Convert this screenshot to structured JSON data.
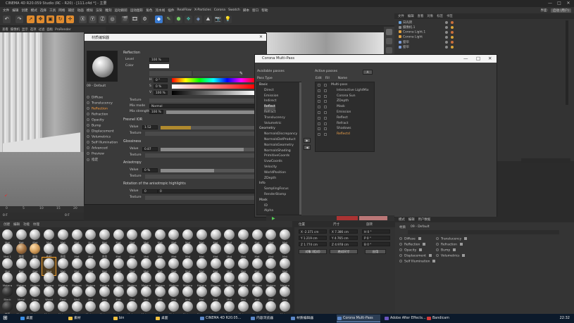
{
  "window": {
    "title": "CINEMA 4D R20.059 Studio (RC - R20) - [111.c4d *] - 主要",
    "minimize": "—",
    "maximize": "□",
    "close": "✕"
  },
  "menubar": {
    "items": [
      "文件",
      "编辑",
      "创建",
      "模式",
      "选择",
      "工具",
      "网格",
      "捕捉",
      "动画",
      "模拟",
      "渲染",
      "雕刻",
      "运动跟踪",
      "运动图形",
      "角色",
      "流水线",
      "插件",
      "RealFlow",
      "X-Particles",
      "Corona",
      "Swatch",
      "脚本",
      "窗口",
      "帮助"
    ],
    "right": {
      "label": "界面:",
      "layout": "启动 (用户)"
    }
  },
  "submenu": {
    "items": [
      "查看",
      "摄像机",
      "显示",
      "选项",
      "过滤",
      "面板",
      "ProRender"
    ]
  },
  "object_manager": {
    "header": [
      "文件",
      "编辑",
      "查看",
      "对象",
      "标签",
      "书签"
    ],
    "objects": [
      {
        "name": "日光阴",
        "color": "#6aa0d8"
      },
      {
        "name": "摄像机.1",
        "color": "#8b8b8b"
      },
      {
        "name": "Corona Light.1",
        "color": "#e0a040"
      },
      {
        "name": "Corona Light",
        "color": "#e0a040"
      },
      {
        "name": "窗帘",
        "color": "#7a9bd6"
      },
      {
        "name": "窗帘",
        "color": "#7a9bd6"
      }
    ]
  },
  "material_editor": {
    "title": "材质编辑器",
    "material_name": "09 - Default",
    "channels": [
      {
        "label": "Diffuse",
        "active": false
      },
      {
        "label": "Translucency",
        "active": false
      },
      {
        "label": "Reflection",
        "active": true
      },
      {
        "label": "Refraction",
        "active": false
      },
      {
        "label": "Opacity",
        "active": false
      },
      {
        "label": "Bump",
        "active": false
      },
      {
        "label": "Displacement",
        "active": false
      },
      {
        "label": "Volumetrics",
        "active": false
      },
      {
        "label": "Self Illumination",
        "active": false
      },
      {
        "label": "Advanced",
        "active": false
      },
      {
        "label": "Preview",
        "active": false
      },
      {
        "label": "指定",
        "active": false
      }
    ],
    "section_title": "Reflection",
    "level_label": "Level",
    "level_value": "100 %",
    "color_label": "Color",
    "h_label": "H",
    "h_value": "0 °",
    "s_label": "S",
    "s_value": "0 %",
    "v_label": "V",
    "v_value": "100 %",
    "texture_label": "Texture",
    "mix_mode_label": "Mix mode",
    "mix_mode_value": "Normal",
    "mix_strength_label": "Mix strength",
    "mix_strength_value": "100 %",
    "fresnel_title": "Fresnel IOR",
    "fresnel_value_label": "Value",
    "fresnel_value": "1.52",
    "fresnel_fill": 0.32,
    "glossiness_title": "Glossiness",
    "gloss_value_label": "Value",
    "gloss_value": "0.87",
    "anisotropy_title": "Anisotropy",
    "aniso_value_label": "Value",
    "aniso_value": "0 %",
    "rotation_title": "Rotation of the anisotropic highlights",
    "rot_value_label": "Value",
    "rot_value": "0",
    "rot_unit": "0"
  },
  "multipass": {
    "title": "Corona Multi-Pass",
    "available_title": "Available passes",
    "pass_type_title": "Pass Type",
    "active_title": "Active passes",
    "add_btn": "A",
    "available": [
      {
        "label": "Basic",
        "cat": true
      },
      {
        "label": "Direct"
      },
      {
        "label": "Emission"
      },
      {
        "label": "Indirect"
      },
      {
        "label": "Reflect",
        "hl": true
      },
      {
        "label": "Refract"
      },
      {
        "label": "Translucency"
      },
      {
        "label": "Volumetric"
      },
      {
        "label": "Geometry",
        "cat": true
      },
      {
        "label": "NormalsDiscrepancy"
      },
      {
        "label": "NormalsDotProduct"
      },
      {
        "label": "NormalsGeometry"
      },
      {
        "label": "NormalsShading"
      },
      {
        "label": "PrimitiveCoords"
      },
      {
        "label": "UvwCoords"
      },
      {
        "label": "Velocity"
      },
      {
        "label": "WorldPosition"
      },
      {
        "label": "ZDepth"
      },
      {
        "label": "Info",
        "cat": true
      },
      {
        "label": "SamplingFocus"
      },
      {
        "label": "RenderStamp"
      },
      {
        "label": "Mask",
        "cat": true
      },
      {
        "label": "ID"
      },
      {
        "label": "Alpha"
      }
    ],
    "active_cols": [
      "Edit",
      "Fill",
      "Name"
    ],
    "active": [
      {
        "label": "Multi-pass"
      },
      {
        "label": "Interactive LightMix"
      },
      {
        "label": "Corona Sun"
      },
      {
        "label": "ZDepth"
      },
      {
        "label": "Mask"
      },
      {
        "label": "Emission"
      },
      {
        "label": "Reflect"
      },
      {
        "label": "Refract"
      },
      {
        "label": "Shadows"
      },
      {
        "label": "Reflectd",
        "or": true
      }
    ],
    "side_btns": [
      "▶",
      "◀"
    ]
  },
  "material_browser": {
    "tabs": [
      "创建",
      "编辑",
      "功能",
      "纹理"
    ],
    "labels": [
      "Mat",
      "Mat",
      "Mat",
      "Mat",
      "Mat",
      "Mat",
      "Mat",
      "Mat",
      "Mat",
      "Mat",
      "Mat",
      "Mat",
      "Mat",
      "Mat",
      "Mat",
      "Mat",
      "Mat",
      "Mat",
      "Mat",
      "Mat",
      "Mat",
      "Mat.1",
      "地毯",
      "纸张",
      "布料",
      "亮面",
      "Mat",
      "Mat",
      "木纹",
      "Mat",
      "Mat",
      "Mat",
      "Mat",
      "Mat",
      "Mat",
      "Mat",
      "Mat",
      "Mat",
      "Mat",
      "Mat",
      "Mat",
      "Mat",
      "Mat",
      "Mat",
      "Mat",
      "Mat",
      "Mat",
      "Mat",
      "Mat",
      "Mat",
      "Mat",
      "Mat",
      "Mat",
      "Mat",
      "Mat",
      "Mat",
      "Mat",
      "Mat",
      "Mat",
      "Mat",
      "Mat",
      "Mat",
      "Mat",
      "Matera",
      "Matera",
      "Matera",
      "Matera",
      "Matera",
      "Matera",
      "Matera",
      "Matera",
      "Matera",
      "Matera",
      "Matera",
      "Matera",
      "Matera",
      "Matera",
      "Matera",
      "Matera",
      "Matera",
      "Matera",
      "Matera",
      "Matera",
      "Matera",
      "Black",
      "Metal",
      "Glass",
      "Wood",
      "Floor",
      "Wall",
      "Mat",
      "Mat",
      "Mat",
      "Mat",
      "Mat",
      "Mat",
      "Mat",
      "Mat",
      "Mat",
      "Mat",
      "Mat",
      "Mat",
      "Mat",
      "Mat",
      "Mat",
      "地面",
      "Matera",
      "Matera",
      "Matera",
      "Matera",
      "Matera",
      "Matera",
      "Matera",
      "Matera",
      "Matera",
      "Matera",
      "Matera",
      "Matera",
      "Matera",
      "Matera",
      "Matera",
      "Matera",
      "Matera",
      "Matera",
      "Matera",
      "Matera"
    ],
    "selected_index": 45
  },
  "coordinates": {
    "headers": [
      "位置",
      "尺寸",
      "旋转"
    ],
    "pos": [
      "X  -2.371 cm",
      "Y  1.219 cm",
      "Z  1.774 cm"
    ],
    "size": [
      "X  7.386 cm",
      "Y  4.765 cm",
      "Z  4.978 cm"
    ],
    "rot": [
      "H  0 °",
      "P  0 °",
      "B  0 °"
    ],
    "mode": "对象 (相对)",
    "size_mode": "绝对尺寸",
    "apply": "应用"
  },
  "attributes": {
    "header": [
      "模式",
      "编辑",
      "用户数据"
    ],
    "material_label": "材质",
    "material_name": "09 - Default",
    "left": [
      "Diffuse",
      "Reflection",
      "Opacity",
      "Displacement",
      "Self Illumination"
    ],
    "right": [
      "Translucency",
      "Refraction",
      "Bump",
      "Volumetrics"
    ]
  },
  "viewport": {
    "ticks": [
      "0",
      "5",
      "10",
      "15",
      "20"
    ],
    "frame_left": "0 F",
    "frame_right": "0 F"
  },
  "taskbar": {
    "items": [
      {
        "label": "桌面",
        "color": "#3a8ee6"
      },
      {
        "label": "素材",
        "color": "#f0c040"
      },
      {
        "label": "bin",
        "color": "#f0c040"
      },
      {
        "label": "桌面",
        "color": "#f0c040"
      },
      {
        "label": "CINEMA 4D R20.05...",
        "color": "#5b86c6"
      },
      {
        "label": "内容浏览器",
        "color": "#5b86c6"
      },
      {
        "label": "材质编辑器",
        "color": "#5b86c6"
      },
      {
        "label": "Corona Multi-Pass",
        "color": "#5b86c6",
        "active": true
      },
      {
        "label": "Adobe After Effects...",
        "color": "#6a55c0"
      },
      {
        "label": "Bandicam",
        "color": "#d43b3b"
      }
    ],
    "time": "22:32"
  }
}
